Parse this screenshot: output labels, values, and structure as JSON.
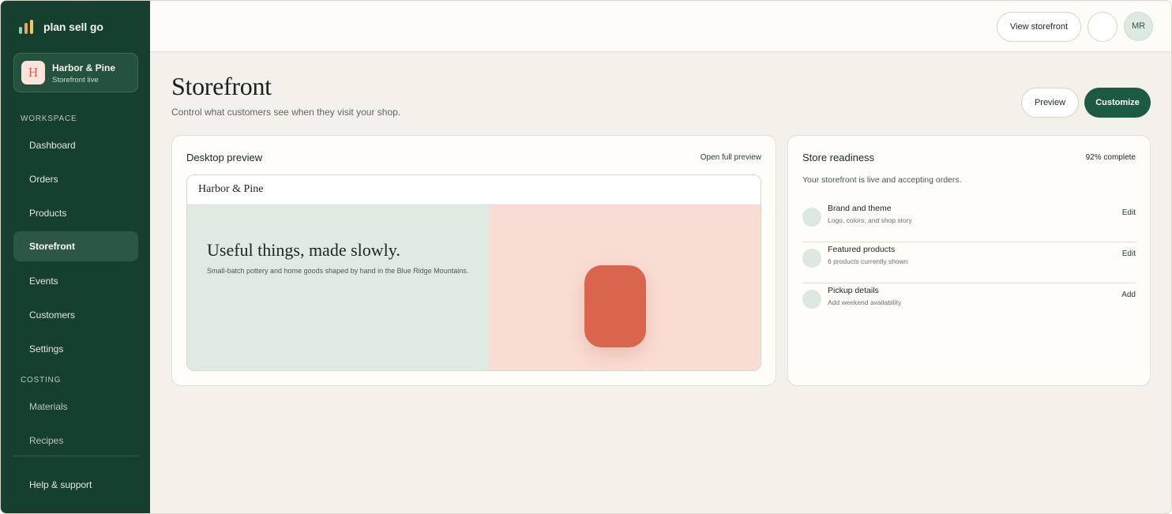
{
  "brand": {
    "name": "plan sell go",
    "colors": {
      "sidebar": "#15402f",
      "primary": "#1d5a43",
      "accent": "#d9664c"
    }
  },
  "store": {
    "initial": "H",
    "name": "Harbor & Pine",
    "status": "Storefront live"
  },
  "sidebar": {
    "workspace_label": "WORKSPACE",
    "workspace_items": [
      {
        "label": "Dashboard"
      },
      {
        "label": "Orders"
      },
      {
        "label": "Products"
      },
      {
        "label": "Storefront",
        "active": true
      },
      {
        "label": "Events"
      },
      {
        "label": "Customers"
      },
      {
        "label": "Settings"
      }
    ],
    "costing_label": "COSTING",
    "costing_items": [
      {
        "label": "Materials"
      },
      {
        "label": "Recipes"
      }
    ],
    "help_label": "Help & support"
  },
  "topbar": {
    "view_storefront": "View storefront",
    "avatar_initials": "MR"
  },
  "page": {
    "title": "Storefront",
    "subtitle": "Control what customers see when they visit your shop.",
    "preview_button": "Preview",
    "customize_button": "Customize"
  },
  "desktop_preview": {
    "title": "Desktop preview",
    "open_link": "Open full preview",
    "site_brand": "Harbor & Pine",
    "hero_heading": "Useful things, made slowly.",
    "hero_sub": "Small-batch pottery and home goods shaped by hand in the Blue Ridge Mountains."
  },
  "readiness": {
    "title": "Store readiness",
    "percent_label": "92% complete",
    "percent_value": 92,
    "status_text": "Your storefront is live and accepting orders.",
    "items": [
      {
        "title": "Brand and theme",
        "sub": "Logo, colors, and shop story",
        "action": "Edit"
      },
      {
        "title": "Featured products",
        "sub": "6 products currently shown",
        "action": "Edit"
      },
      {
        "title": "Pickup details",
        "sub": "Add weekend availability",
        "action": "Add"
      }
    ]
  }
}
